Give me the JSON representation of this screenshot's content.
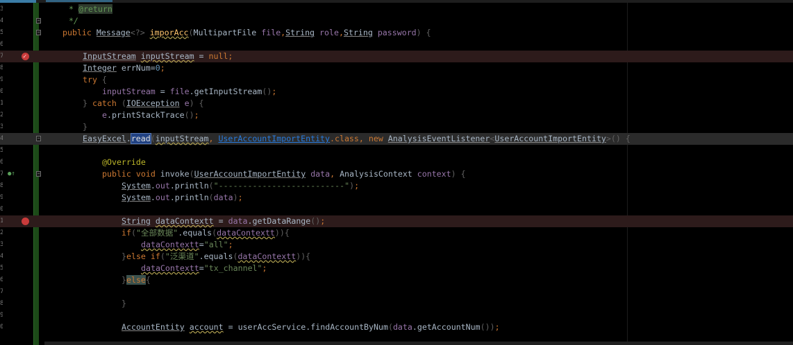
{
  "editor": {
    "lines": [
      {
        "num": "3",
        "indent": 99,
        "parts": [
          {
            "t": "* ",
            "c": "cm"
          },
          {
            "t": "@return",
            "c": "tag"
          }
        ]
      },
      {
        "num": "4",
        "indent": 99,
        "fold": true,
        "parts": [
          {
            "t": "*/",
            "c": "cm"
          }
        ]
      },
      {
        "num": "5",
        "indent": 90,
        "fold": true,
        "parts": [
          {
            "t": "public ",
            "c": "kw"
          },
          {
            "t": "Message",
            "c": "ty"
          },
          {
            "t": "<?>",
            "c": "gr"
          },
          {
            "t": " ",
            "c": "pl"
          },
          {
            "t": "imporAcc",
            "c": "fn wv"
          },
          {
            "t": "(",
            "c": "gr"
          },
          {
            "t": "MultipartFile ",
            "c": "pl"
          },
          {
            "t": "file",
            "c": "pr"
          },
          {
            "t": ",",
            "c": "kw"
          },
          {
            "t": "String",
            "c": "ty"
          },
          {
            "t": " ",
            "c": "pl"
          },
          {
            "t": "role",
            "c": "pr"
          },
          {
            "t": ",",
            "c": "kw"
          },
          {
            "t": "String",
            "c": "ty"
          },
          {
            "t": " ",
            "c": "pl"
          },
          {
            "t": "password",
            "c": "pr"
          },
          {
            "t": ") {",
            "c": "gr"
          }
        ]
      },
      {
        "num": "6",
        "indent": 90,
        "parts": []
      },
      {
        "num": "7",
        "indent": 119,
        "bg": "bp",
        "bp": "check",
        "parts": [
          {
            "t": "InputStream",
            "c": "ty"
          },
          {
            "t": " ",
            "c": "pl"
          },
          {
            "t": "inputStream",
            "c": "pl wv"
          },
          {
            "t": " = ",
            "c": "pl"
          },
          {
            "t": "null",
            "c": "kw"
          },
          {
            "t": ";",
            "c": "kw"
          }
        ]
      },
      {
        "num": "8",
        "indent": 119,
        "parts": [
          {
            "t": "Integer",
            "c": "ty"
          },
          {
            "t": " errNum=",
            "c": "pl"
          },
          {
            "t": "0",
            "c": "num"
          },
          {
            "t": ";",
            "c": "kw"
          }
        ]
      },
      {
        "num": "9",
        "indent": 119,
        "parts": [
          {
            "t": "try",
            "c": "kw"
          },
          {
            "t": " {",
            "c": "gr"
          }
        ]
      },
      {
        "num": "0",
        "indent": 147,
        "parts": [
          {
            "t": "inputStream",
            "c": "pr"
          },
          {
            "t": " = ",
            "c": "pl"
          },
          {
            "t": "file",
            "c": "pr"
          },
          {
            "t": ".getInputStream",
            "c": "pl"
          },
          {
            "t": "()",
            "c": "gr"
          },
          {
            "t": ";",
            "c": "kw"
          }
        ]
      },
      {
        "num": "1",
        "indent": 119,
        "parts": [
          {
            "t": "} ",
            "c": "gr"
          },
          {
            "t": "catch",
            "c": "kw"
          },
          {
            "t": " (",
            "c": "gr"
          },
          {
            "t": "IOException",
            "c": "ty"
          },
          {
            "t": " ",
            "c": "pl"
          },
          {
            "t": "e",
            "c": "pr"
          },
          {
            "t": ") {",
            "c": "gr"
          }
        ]
      },
      {
        "num": "2",
        "indent": 147,
        "parts": [
          {
            "t": "e",
            "c": "pr"
          },
          {
            "t": ".printStackTrace",
            "c": "pl"
          },
          {
            "t": "()",
            "c": "gr"
          },
          {
            "t": ";",
            "c": "kw"
          }
        ]
      },
      {
        "num": "3",
        "indent": 119,
        "parts": [
          {
            "t": "}",
            "c": "gr"
          }
        ]
      },
      {
        "num": "4",
        "indent": 119,
        "bg": "hl",
        "fold": true,
        "parts": [
          {
            "t": "EasyExcel",
            "c": "ty"
          },
          {
            "t": ".",
            "c": "pl"
          },
          {
            "t": "read",
            "c": "sel"
          },
          {
            "t": "(",
            "c": "gr"
          },
          {
            "t": "inputStream",
            "c": "pl wv"
          },
          {
            "t": ", ",
            "c": "kw"
          },
          {
            "t": "UserAccountImportEntity",
            "c": "lk"
          },
          {
            "t": ".class",
            "c": "kw"
          },
          {
            "t": ", ",
            "c": "kw"
          },
          {
            "t": "new ",
            "c": "kw"
          },
          {
            "t": "AnalysisEventListener",
            "c": "ty"
          },
          {
            "t": "<",
            "c": "gr"
          },
          {
            "t": "UserAccountImportEntity",
            "c": "ty"
          },
          {
            "t": ">() {",
            "c": "gr"
          }
        ]
      },
      {
        "num": "5",
        "indent": 147,
        "parts": []
      },
      {
        "num": "6",
        "indent": 147,
        "parts": [
          {
            "t": "@Override",
            "c": "an"
          }
        ]
      },
      {
        "num": "7",
        "indent": 147,
        "fold": true,
        "ov": true,
        "parts": [
          {
            "t": "public ",
            "c": "kw"
          },
          {
            "t": "void ",
            "c": "kw"
          },
          {
            "t": "invoke",
            "c": "pl"
          },
          {
            "t": "(",
            "c": "gr"
          },
          {
            "t": "UserAccountImportEntity",
            "c": "ty"
          },
          {
            "t": " ",
            "c": "pl"
          },
          {
            "t": "data",
            "c": "pr"
          },
          {
            "t": ", ",
            "c": "kw"
          },
          {
            "t": "AnalysisContext ",
            "c": "pl"
          },
          {
            "t": "context",
            "c": "pr"
          },
          {
            "t": ") {",
            "c": "gr"
          }
        ]
      },
      {
        "num": "8",
        "indent": 175,
        "parts": [
          {
            "t": "System",
            "c": "ty"
          },
          {
            "t": ".",
            "c": "pl"
          },
          {
            "t": "out",
            "c": "pr"
          },
          {
            "t": ".println",
            "c": "pl"
          },
          {
            "t": "(",
            "c": "gr"
          },
          {
            "t": "\"--------------------------\"",
            "c": "st"
          },
          {
            "t": ")",
            "c": "gr"
          },
          {
            "t": ";",
            "c": "kw"
          }
        ]
      },
      {
        "num": "9",
        "indent": 175,
        "parts": [
          {
            "t": "System",
            "c": "ty"
          },
          {
            "t": ".",
            "c": "pl"
          },
          {
            "t": "out",
            "c": "pr"
          },
          {
            "t": ".println",
            "c": "pl"
          },
          {
            "t": "(",
            "c": "gr"
          },
          {
            "t": "data",
            "c": "pr"
          },
          {
            "t": ")",
            "c": "gr"
          },
          {
            "t": ";",
            "c": "kw"
          }
        ]
      },
      {
        "num": "0",
        "indent": 175,
        "parts": []
      },
      {
        "num": "1",
        "indent": 175,
        "bg": "bp",
        "bp": "dot",
        "parts": [
          {
            "t": "String",
            "c": "ty"
          },
          {
            "t": " ",
            "c": "pl"
          },
          {
            "t": "dataContextt",
            "c": "pl wv"
          },
          {
            "t": " = ",
            "c": "pl"
          },
          {
            "t": "data",
            "c": "pr"
          },
          {
            "t": ".getDataRange",
            "c": "pl"
          },
          {
            "t": "()",
            "c": "gr"
          },
          {
            "t": ";",
            "c": "kw"
          }
        ]
      },
      {
        "num": "2",
        "indent": 175,
        "parts": [
          {
            "t": "if",
            "c": "kw"
          },
          {
            "t": "(",
            "c": "gr"
          },
          {
            "t": "\"全部数据\"",
            "c": "st"
          },
          {
            "t": ".equals",
            "c": "pl"
          },
          {
            "t": "(",
            "c": "gr"
          },
          {
            "t": "dataContextt",
            "c": "pr wv"
          },
          {
            "t": ")){",
            "c": "gr"
          }
        ]
      },
      {
        "num": "3",
        "indent": 203,
        "parts": [
          {
            "t": "dataContextt",
            "c": "pr wv"
          },
          {
            "t": "=",
            "c": "pl"
          },
          {
            "t": "\"all\"",
            "c": "st"
          },
          {
            "t": ";",
            "c": "kw"
          }
        ]
      },
      {
        "num": "4",
        "indent": 175,
        "parts": [
          {
            "t": "}",
            "c": "gr"
          },
          {
            "t": "else ",
            "c": "kw"
          },
          {
            "t": "if",
            "c": "kw"
          },
          {
            "t": "(",
            "c": "gr"
          },
          {
            "t": "\"泛渠道\"",
            "c": "st"
          },
          {
            "t": ".equals",
            "c": "pl"
          },
          {
            "t": "(",
            "c": "gr"
          },
          {
            "t": "dataContextt",
            "c": "pr wv"
          },
          {
            "t": ")){",
            "c": "gr"
          }
        ]
      },
      {
        "num": "5",
        "indent": 203,
        "parts": [
          {
            "t": "dataContextt",
            "c": "pr wv"
          },
          {
            "t": "=",
            "c": "pl"
          },
          {
            "t": "\"tx_channel\"",
            "c": "st"
          },
          {
            "t": ";",
            "c": "kw"
          }
        ]
      },
      {
        "num": "6",
        "indent": 175,
        "parts": [
          {
            "t": "}",
            "c": "gr"
          },
          {
            "t": "else",
            "c": "kw kwhl"
          },
          {
            "t": "{",
            "c": "gr"
          }
        ]
      },
      {
        "num": "7",
        "indent": 175,
        "parts": []
      },
      {
        "num": "8",
        "indent": 175,
        "parts": [
          {
            "t": "}",
            "c": "gr"
          }
        ]
      },
      {
        "num": "9",
        "indent": 175,
        "parts": []
      },
      {
        "num": "0",
        "indent": 175,
        "parts": [
          {
            "t": "AccountEntity",
            "c": "ty"
          },
          {
            "t": " ",
            "c": "pl"
          },
          {
            "t": "account",
            "c": "pl wv"
          },
          {
            "t": " = ",
            "c": "pl"
          },
          {
            "t": "userAccService",
            "c": "pl"
          },
          {
            "t": ".findAccountByNum",
            "c": "pl"
          },
          {
            "t": "(",
            "c": "gr"
          },
          {
            "t": "data",
            "c": "pr"
          },
          {
            "t": ".getAccountNum",
            "c": "pl"
          },
          {
            "t": "())",
            "c": "gr"
          },
          {
            "t": ";",
            "c": "kw"
          }
        ]
      }
    ]
  }
}
